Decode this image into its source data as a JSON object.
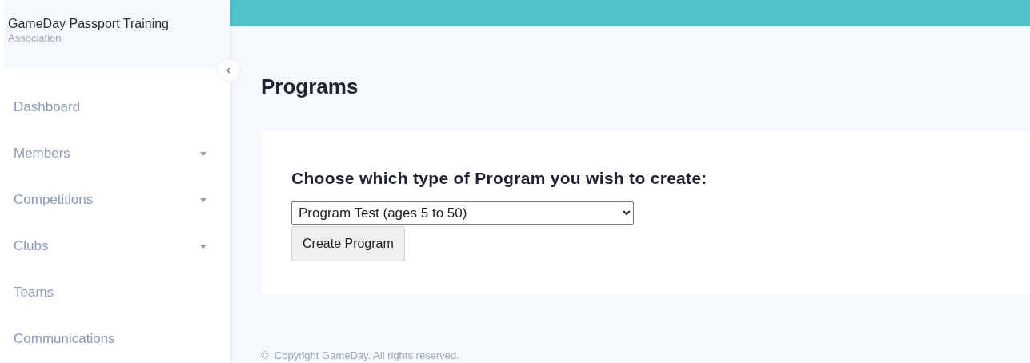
{
  "sidebar": {
    "org_name": "GameDay Passport Training",
    "org_type": "Association",
    "items": [
      {
        "label": "Dashboard",
        "has_submenu": false
      },
      {
        "label": "Members",
        "has_submenu": true
      },
      {
        "label": "Competitions",
        "has_submenu": true
      },
      {
        "label": "Clubs",
        "has_submenu": true
      },
      {
        "label": "Teams",
        "has_submenu": false
      },
      {
        "label": "Communications",
        "has_submenu": false
      }
    ]
  },
  "page_title": "Programs",
  "card": {
    "heading": "Choose which type of Program you wish to create:",
    "select_value": "Program Test (ages 5 to 50)",
    "button": "Create Program"
  },
  "footer": "©  Copyright GameDay. All rights reserved."
}
